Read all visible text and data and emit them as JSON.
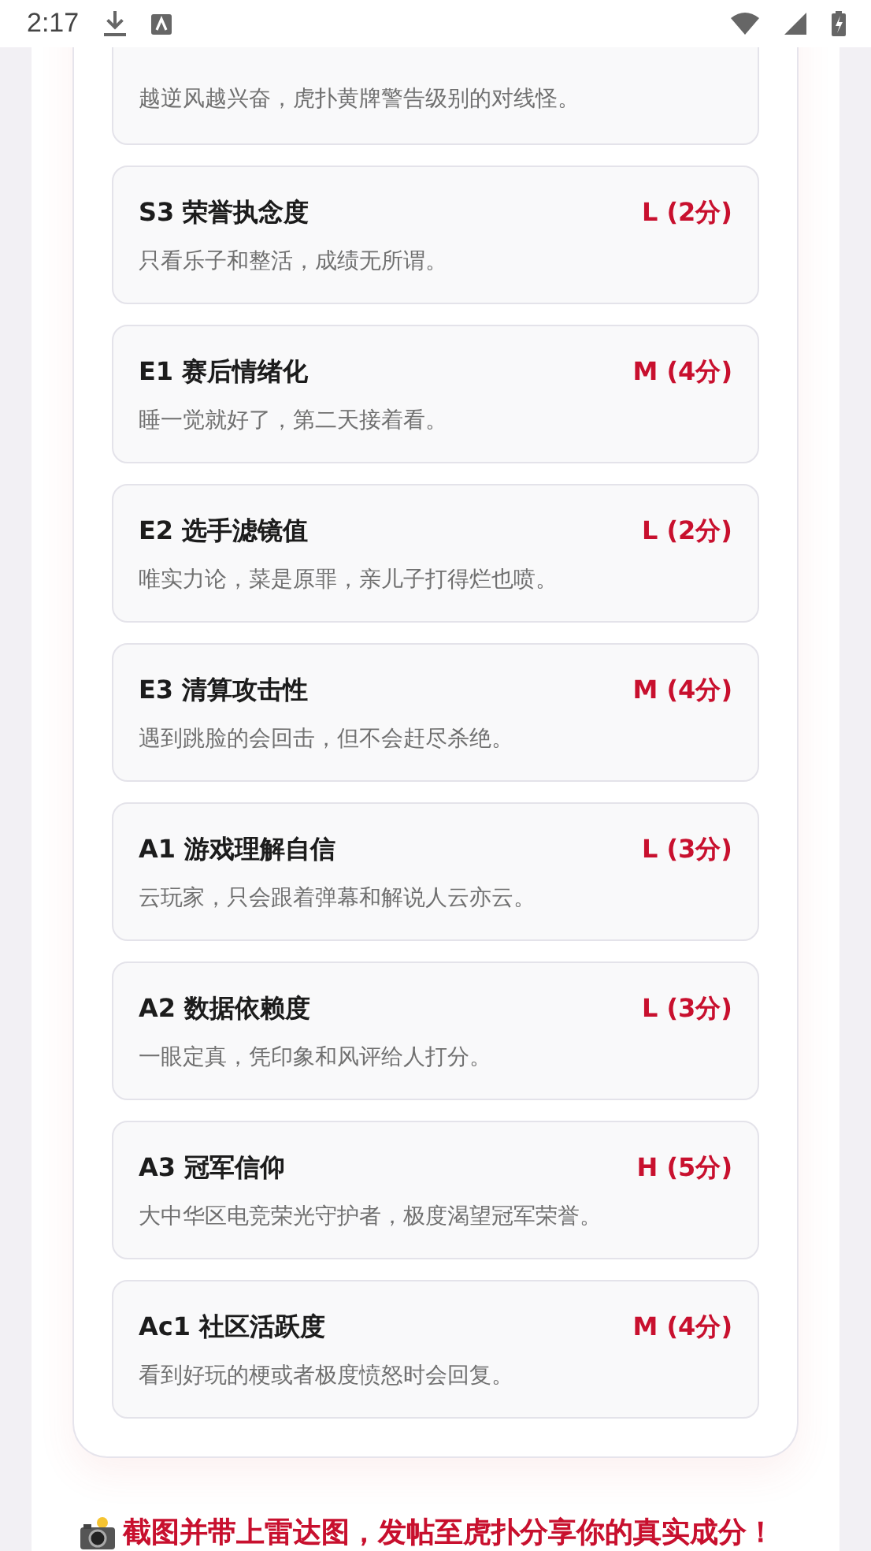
{
  "status_bar": {
    "time": "2:17"
  },
  "items": [
    {
      "desc": "越逆风越兴奋，虎扑黄牌警告级别的对线怪。"
    },
    {
      "title": "S3 荣誉执念度",
      "score": "L (2分)",
      "desc": "只看乐子和整活，成绩无所谓。"
    },
    {
      "title": "E1 赛后情绪化",
      "score": "M (4分)",
      "desc": "睡一觉就好了，第二天接着看。"
    },
    {
      "title": "E2 选手滤镜值",
      "score": "L (2分)",
      "desc": "唯实力论，菜是原罪，亲儿子打得烂也喷。"
    },
    {
      "title": "E3 清算攻击性",
      "score": "M (4分)",
      "desc": "遇到跳脸的会回击，但不会赶尽杀绝。"
    },
    {
      "title": "A1 游戏理解自信",
      "score": "L (3分)",
      "desc": "云玩家，只会跟着弹幕和解说人云亦云。"
    },
    {
      "title": "A2 数据依赖度",
      "score": "L (3分)",
      "desc": "一眼定真，凭印象和风评给人打分。"
    },
    {
      "title": "A3 冠军信仰",
      "score": "H (5分)",
      "desc": "大中华区电竞荣光守护者，极度渴望冠军荣誉。"
    },
    {
      "title": "Ac1 社区活跃度",
      "score": "M (4分)",
      "desc": "看到好玩的梗或者极度愤怒时会回复。"
    }
  ],
  "footer": {
    "text": "截图并带上雷达图，发帖至虎扑分享你的真实成分！"
  }
}
